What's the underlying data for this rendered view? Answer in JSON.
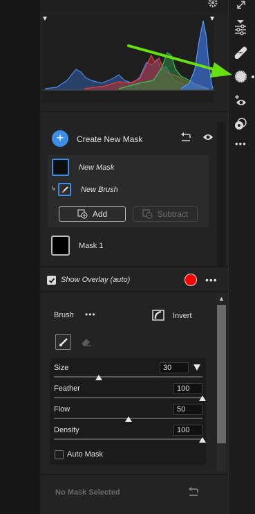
{
  "colors": {
    "accent_blue": "#3a8ee8",
    "overlay_red": "#ff0000",
    "arrow_green": "#66e011"
  },
  "rightbar": {
    "icons": [
      "expand-icon",
      "sliders-icon",
      "healing-bandage-icon",
      "masking-icon",
      "redeye-icon",
      "presets-icon",
      "more-icon"
    ]
  },
  "masks": {
    "create_label": "Create New Mask",
    "new_mask_label": "New Mask",
    "new_brush_label": "New Brush",
    "add_label": "Add",
    "subtract_label": "Subtract",
    "mask1_label": "Mask 1"
  },
  "overlay": {
    "label": "Show Overlay (auto)",
    "checked": true
  },
  "brush": {
    "label": "Brush",
    "invert_label": "Invert",
    "size_label": "Size",
    "size_value": "30",
    "size_level": 0.3,
    "feather_label": "Feather",
    "feather_value": "100",
    "feather_level": 1.0,
    "flow_label": "Flow",
    "flow_value": "50",
    "flow_level": 0.5,
    "density_label": "Density",
    "density_value": "100",
    "density_level": 1.0,
    "auto_mask_label": "Auto Mask"
  },
  "footer": {
    "no_mask_label": "No Mask Selected"
  }
}
